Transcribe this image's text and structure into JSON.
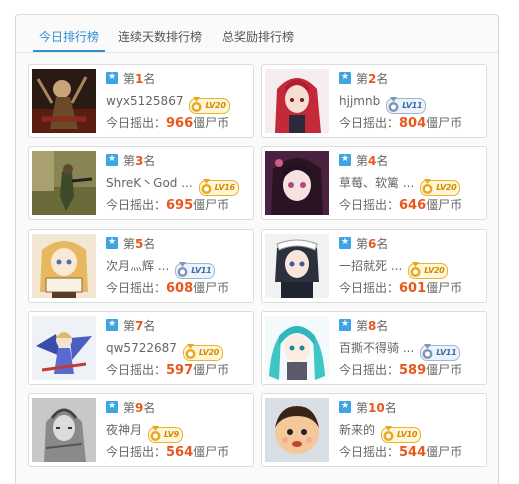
{
  "tabs": [
    {
      "label": "今日排行榜",
      "active": true
    },
    {
      "label": "连续天数排行榜",
      "active": false
    },
    {
      "label": "总奖励排行榜",
      "active": false
    }
  ],
  "rank_prefix": "第",
  "rank_suffix": "名",
  "coin_label": "今日摇出：",
  "coin_unit": "僵尸币",
  "colors": {
    "accent": "#2f8fd0",
    "amount": "#e8571d",
    "bookmark": "#3da5e6"
  },
  "entries": [
    {
      "rank": "1",
      "name": "wyx5125867",
      "level": "LV20",
      "badge": "gold",
      "coins": "966",
      "avatar": "dark-fantasy-figure"
    },
    {
      "rank": "2",
      "name": "hjjmnb",
      "level": "LV11",
      "badge": "silver",
      "coins": "804",
      "avatar": "red-hair-anime-girl"
    },
    {
      "rank": "3",
      "name": "ShreK丶God ...",
      "level": "LV16",
      "badge": "gold",
      "coins": "695",
      "avatar": "game-soldier-scene"
    },
    {
      "rank": "4",
      "name": "草莓、软篱 ...",
      "level": "LV20",
      "badge": "gold",
      "coins": "646",
      "avatar": "dark-hair-anime-girl"
    },
    {
      "rank": "5",
      "name": "次月灬辉 ...",
      "level": "LV11",
      "badge": "silver",
      "coins": "608",
      "avatar": "blonde-anime-girl"
    },
    {
      "rank": "6",
      "name": "一招就死 ...",
      "level": "LV20",
      "badge": "gold",
      "coins": "601",
      "avatar": "anime-boy-maid"
    },
    {
      "rank": "7",
      "name": "qw5722687",
      "level": "LV20",
      "badge": "gold",
      "coins": "597",
      "avatar": "mecha-girl"
    },
    {
      "rank": "8",
      "name": "百撕不得骑 ...",
      "level": "LV11",
      "badge": "silver",
      "coins": "589",
      "avatar": "teal-twintail-girl"
    },
    {
      "rank": "9",
      "name": "夜神月",
      "level": "LV9",
      "badge": "gold",
      "coins": "564",
      "avatar": "sketch-character"
    },
    {
      "rank": "10",
      "name": "新来的",
      "level": "LV10",
      "badge": "gold",
      "coins": "544",
      "avatar": "cartoon-face"
    }
  ]
}
